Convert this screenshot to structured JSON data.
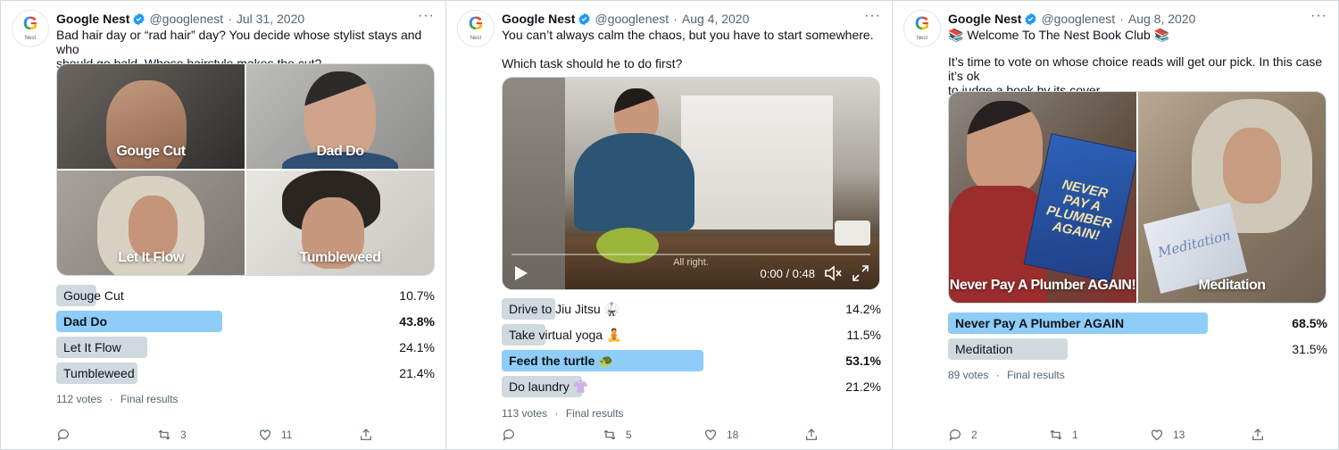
{
  "tweets": [
    {
      "name": "Google Nest",
      "handle": "@googlenest",
      "date": "Jul 31, 2020",
      "avatar_brand": "G",
      "avatar_sub": "Nest",
      "text_lines": [
        "Bad hair day or “rad hair” day? You decide whose stylist stays and who",
        "should go bald. Whose hairstyle makes the cut?"
      ],
      "media_captions": [
        "Gouge Cut",
        "Dad Do",
        "Let It Flow",
        "Tumbleweed"
      ],
      "poll": [
        {
          "label": "Gouge Cut",
          "pct": "10.7%",
          "value": 10.7,
          "winner": false
        },
        {
          "label": "Dad Do",
          "pct": "43.8%",
          "value": 43.8,
          "winner": true
        },
        {
          "label": "Let It Flow",
          "pct": "24.1%",
          "value": 24.1,
          "winner": false
        },
        {
          "label": "Tumbleweed",
          "pct": "21.4%",
          "value": 21.4,
          "winner": false
        }
      ],
      "votes": "112 votes",
      "final": "Final results",
      "replies": "",
      "retweets": "3",
      "likes": "11"
    },
    {
      "name": "Google Nest",
      "handle": "@googlenest",
      "date": "Aug 4, 2020",
      "avatar_brand": "G",
      "avatar_sub": "Nest",
      "text_lines": [
        "You can’t always calm the chaos, but you have to start somewhere.",
        "",
        "Which task should he to do first?"
      ],
      "video": {
        "subtitle": "All right.",
        "time": "0:00 / 0:48"
      },
      "poll": [
        {
          "label": "Drive to Jiu Jitsu 🥋",
          "pct": "14.2%",
          "value": 14.2,
          "winner": false
        },
        {
          "label": "Take virtual yoga 🧘",
          "pct": "11.5%",
          "value": 11.5,
          "winner": false
        },
        {
          "label": "Feed the turtle 🐢",
          "pct": "53.1%",
          "value": 53.1,
          "winner": true
        },
        {
          "label": "Do laundry 👚",
          "pct": "21.2%",
          "value": 21.2,
          "winner": false
        }
      ],
      "votes": "113 votes",
      "final": "Final results",
      "replies": "",
      "retweets": "5",
      "likes": "18"
    },
    {
      "name": "Google Nest",
      "handle": "@googlenest",
      "date": "Aug 8, 2020",
      "avatar_brand": "G",
      "avatar_sub": "Nest",
      "text_lines": [
        "📚 Welcome To The Nest Book Club 📚",
        "",
        "It’s time to vote on whose choice reads will get our pick. In this case it’s ok",
        "to judge a book by its cover."
      ],
      "media_captions": [
        "Never Pay A Plumber AGAIN!",
        "Meditation"
      ],
      "book_text": {
        "left": "NEVER PAY A PLUMBER AGAIN!",
        "right": "Meditation"
      },
      "poll": [
        {
          "label": "Never Pay A Plumber AGAIN",
          "pct": "68.5%",
          "value": 68.5,
          "winner": true
        },
        {
          "label": "Meditation",
          "pct": "31.5%",
          "value": 31.5,
          "winner": false
        }
      ],
      "votes": "89 votes",
      "final": "Final results",
      "replies": "2",
      "retweets": "1",
      "likes": "13"
    }
  ],
  "separator": "·",
  "more": "···"
}
